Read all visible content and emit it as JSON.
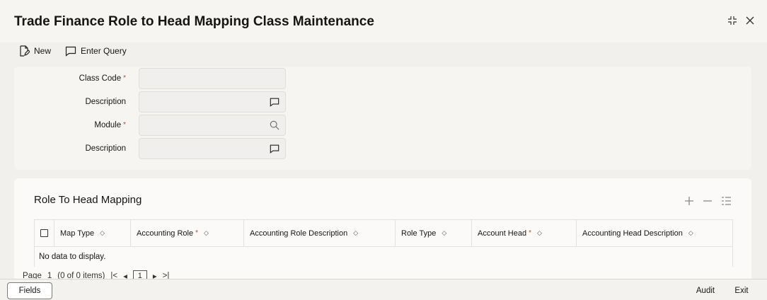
{
  "window": {
    "title": "Trade Finance Role to Head Mapping Class Maintenance"
  },
  "toolbar": {
    "new_label": "New",
    "enter_query_label": "Enter Query"
  },
  "form": {
    "class_code_label": "Class Code",
    "description_label": "Description",
    "module_label": "Module",
    "description2_label": "Description",
    "required_marker": "*"
  },
  "grid": {
    "title": "Role To Head Mapping",
    "columns": [
      {
        "label": "Map Type",
        "required": false
      },
      {
        "label": "Accounting Role",
        "required": true
      },
      {
        "label": "Accounting Role Description",
        "required": false
      },
      {
        "label": "Role Type",
        "required": false
      },
      {
        "label": "Account Head",
        "required": true
      },
      {
        "label": "Accounting Head Description",
        "required": false
      }
    ],
    "empty_text": "No data to display.",
    "pager": {
      "page_label": "Page",
      "page_value": "1",
      "items_text": "(0 of 0 items)",
      "current_page": "1"
    }
  },
  "footer": {
    "fields_label": "Fields",
    "audit_label": "Audit",
    "exit_label": "Exit"
  },
  "colors": {
    "required": "#c74634",
    "text": "#161513",
    "background": "#f2f0ec"
  }
}
